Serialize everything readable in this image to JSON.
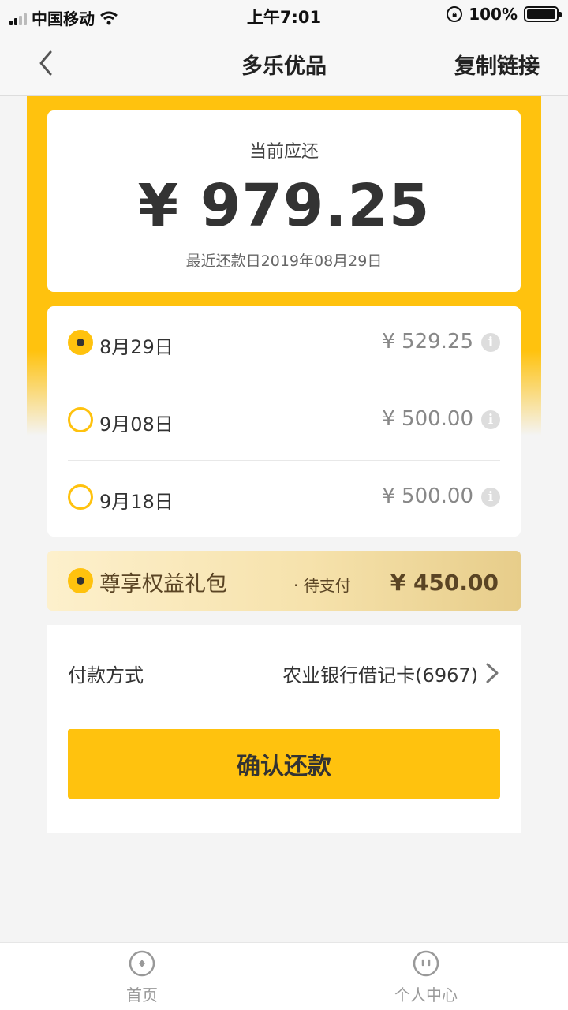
{
  "status_bar": {
    "carrier": "中国移动",
    "time": "上午7:01",
    "battery": "100%"
  },
  "nav": {
    "title": "多乐优品",
    "action": "复制链接"
  },
  "summary": {
    "label": "当前应还",
    "amount": "¥ 979.25",
    "due_date": "最近还款日2019年08月29日"
  },
  "installments": [
    {
      "date": "8月29日",
      "amount": "¥ 529.25",
      "selected": true
    },
    {
      "date": "9月08日",
      "amount": "¥ 500.00",
      "selected": false
    },
    {
      "date": "9月18日",
      "amount": "¥ 500.00",
      "selected": false
    }
  ],
  "gift": {
    "name": "尊享权益礼包",
    "separator": "·",
    "status": "待支付",
    "amount": "¥ 450.00",
    "selected": true
  },
  "payment": {
    "label": "付款方式",
    "method": "农业银行借记卡(6967)"
  },
  "confirm_label": "确认还款",
  "tabs": [
    {
      "label": "首页",
      "icon": "home-icon"
    },
    {
      "label": "个人中心",
      "icon": "user-center-icon"
    }
  ],
  "colors": {
    "accent": "#ffc20e",
    "gift_text": "#5a4424"
  }
}
